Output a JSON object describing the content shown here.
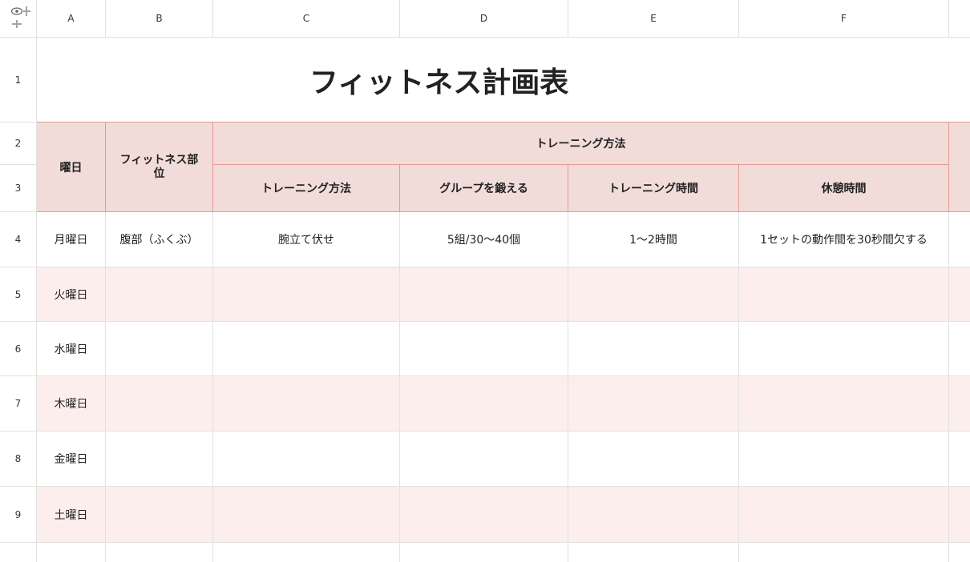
{
  "columns": [
    "A",
    "B",
    "C",
    "D",
    "E",
    "F"
  ],
  "rows": [
    "1",
    "2",
    "3",
    "4",
    "5",
    "6",
    "7",
    "8",
    "9"
  ],
  "title": "フィットネス計画表",
  "headers": {
    "day": "曜日",
    "part": "フィットネス部位",
    "group_header": "トレーニング方法",
    "method": "トレーニング方法",
    "group": "グループを鍛える",
    "time": "トレーニング時間",
    "rest": "休憩時間"
  },
  "data_rows": [
    {
      "day": "月曜日",
      "part": "腹部（ふくぶ）",
      "method": "腕立て伏せ",
      "group": "5組/30～40個",
      "time": "1～2時間",
      "rest": "1セットの動作間を30秒間欠する"
    },
    {
      "day": "火曜日",
      "part": "",
      "method": "",
      "group": "",
      "time": "",
      "rest": ""
    },
    {
      "day": "水曜日",
      "part": "",
      "method": "",
      "group": "",
      "time": "",
      "rest": ""
    },
    {
      "day": "木曜日",
      "part": "",
      "method": "",
      "group": "",
      "time": "",
      "rest": ""
    },
    {
      "day": "金曜日",
      "part": "",
      "method": "",
      "group": "",
      "time": "",
      "rest": ""
    },
    {
      "day": "土曜日",
      "part": "",
      "method": "",
      "group": "",
      "time": "",
      "rest": ""
    }
  ]
}
